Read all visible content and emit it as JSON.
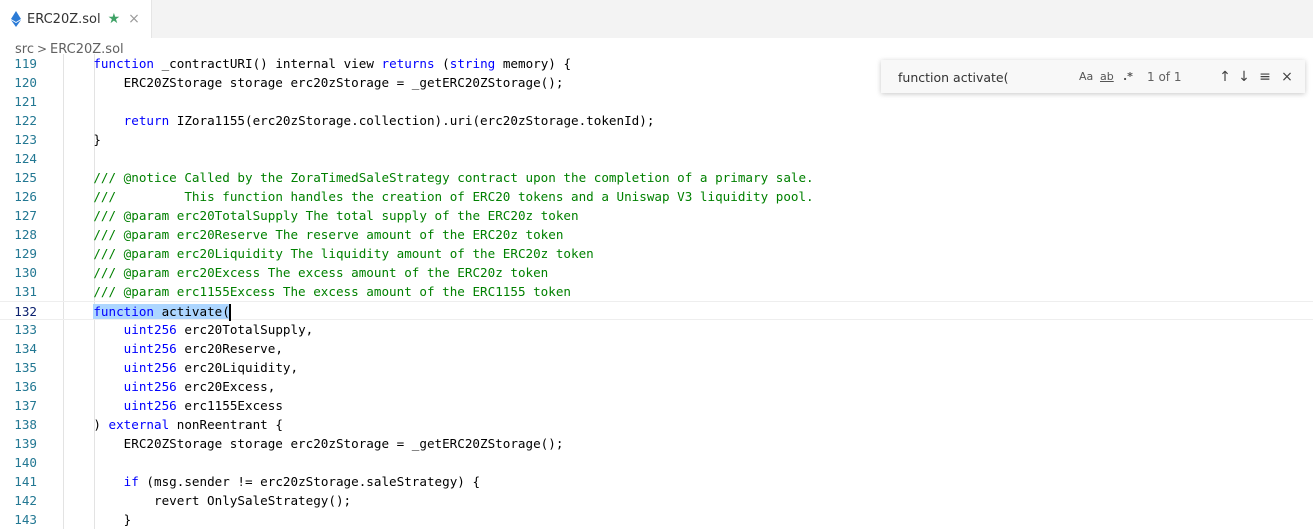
{
  "tab": {
    "title": "ERC20Z.sol",
    "star_icon": "★",
    "close_icon": "×",
    "eth_color": "#2b7bd6"
  },
  "breadcrumb": {
    "folder": "src",
    "separator": ">",
    "file": "ERC20Z.sol"
  },
  "find": {
    "query": "function activate(",
    "match_case": "Aa",
    "whole_word": "ab",
    "regex": ".*",
    "count": "1 of 1",
    "prev_icon": "↑",
    "next_icon": "↓",
    "selection_icon": "≡",
    "close_icon": "×"
  },
  "editor": {
    "lines": [
      {
        "n": "119",
        "tokens": [
          [
            "",
            "    "
          ],
          [
            "kw",
            "function"
          ],
          [
            "",
            " _contractURI() internal view "
          ],
          [
            "kw",
            "returns"
          ],
          [
            "",
            " ("
          ],
          [
            "ty",
            "string"
          ],
          [
            "",
            " memory) {"
          ]
        ]
      },
      {
        "n": "120",
        "tokens": [
          [
            "",
            "        ERC20ZStorage storage erc20zStorage = _getERC20ZStorage();"
          ]
        ]
      },
      {
        "n": "121",
        "tokens": [
          [
            "",
            ""
          ]
        ]
      },
      {
        "n": "122",
        "tokens": [
          [
            "",
            "        "
          ],
          [
            "kw",
            "return"
          ],
          [
            "",
            " IZora1155(erc20zStorage.collection).uri(erc20zStorage.tokenId);"
          ]
        ]
      },
      {
        "n": "123",
        "tokens": [
          [
            "",
            "    }"
          ]
        ]
      },
      {
        "n": "124",
        "tokens": [
          [
            "",
            ""
          ]
        ]
      },
      {
        "n": "125",
        "tokens": [
          [
            "",
            "    "
          ],
          [
            "cm",
            "/// @notice Called by the ZoraTimedSaleStrategy contract upon the completion of a primary sale."
          ]
        ]
      },
      {
        "n": "126",
        "tokens": [
          [
            "",
            "    "
          ],
          [
            "cm",
            "///         This function handles the creation of ERC20 tokens and a Uniswap V3 liquidity pool."
          ]
        ]
      },
      {
        "n": "127",
        "tokens": [
          [
            "",
            "    "
          ],
          [
            "cm",
            "/// @param erc20TotalSupply The total supply of the ERC20z token"
          ]
        ]
      },
      {
        "n": "128",
        "tokens": [
          [
            "",
            "    "
          ],
          [
            "cm",
            "/// @param erc20Reserve The reserve amount of the ERC20z token"
          ]
        ]
      },
      {
        "n": "129",
        "tokens": [
          [
            "",
            "    "
          ],
          [
            "cm",
            "/// @param erc20Liquidity The liquidity amount of the ERC20z token"
          ]
        ]
      },
      {
        "n": "130",
        "tokens": [
          [
            "",
            "    "
          ],
          [
            "cm",
            "/// @param erc20Excess The excess amount of the ERC20z token"
          ]
        ]
      },
      {
        "n": "131",
        "tokens": [
          [
            "",
            "    "
          ],
          [
            "cm",
            "/// @param erc1155Excess The excess amount of the ERC1155 token"
          ]
        ]
      },
      {
        "n": "132",
        "tokens": [
          [
            "",
            "    "
          ],
          [
            "kw hl",
            "function"
          ],
          [
            "hl",
            " activate("
          ],
          [
            "cursor",
            ""
          ]
        ],
        "current": true
      },
      {
        "n": "133",
        "tokens": [
          [
            "",
            "        "
          ],
          [
            "ty",
            "uint256"
          ],
          [
            "",
            " erc20TotalSupply,"
          ]
        ]
      },
      {
        "n": "134",
        "tokens": [
          [
            "",
            "        "
          ],
          [
            "ty",
            "uint256"
          ],
          [
            "",
            " erc20Reserve,"
          ]
        ]
      },
      {
        "n": "135",
        "tokens": [
          [
            "",
            "        "
          ],
          [
            "ty",
            "uint256"
          ],
          [
            "",
            " erc20Liquidity,"
          ]
        ]
      },
      {
        "n": "136",
        "tokens": [
          [
            "",
            "        "
          ],
          [
            "ty",
            "uint256"
          ],
          [
            "",
            " erc20Excess,"
          ]
        ]
      },
      {
        "n": "137",
        "tokens": [
          [
            "",
            "        "
          ],
          [
            "ty",
            "uint256"
          ],
          [
            "",
            " erc1155Excess"
          ]
        ]
      },
      {
        "n": "138",
        "tokens": [
          [
            "",
            "    ) "
          ],
          [
            "kw",
            "external"
          ],
          [
            "",
            " nonReentrant {"
          ]
        ]
      },
      {
        "n": "139",
        "tokens": [
          [
            "",
            "        ERC20ZStorage storage erc20zStorage = _getERC20ZStorage();"
          ]
        ]
      },
      {
        "n": "140",
        "tokens": [
          [
            "",
            ""
          ]
        ]
      },
      {
        "n": "141",
        "tokens": [
          [
            "",
            "        "
          ],
          [
            "kw",
            "if"
          ],
          [
            "",
            " (msg.sender != erc20zStorage.saleStrategy) {"
          ]
        ]
      },
      {
        "n": "142",
        "tokens": [
          [
            "",
            "            revert OnlySaleStrategy();"
          ]
        ]
      },
      {
        "n": "143",
        "tokens": [
          [
            "",
            "        }"
          ]
        ]
      }
    ]
  }
}
